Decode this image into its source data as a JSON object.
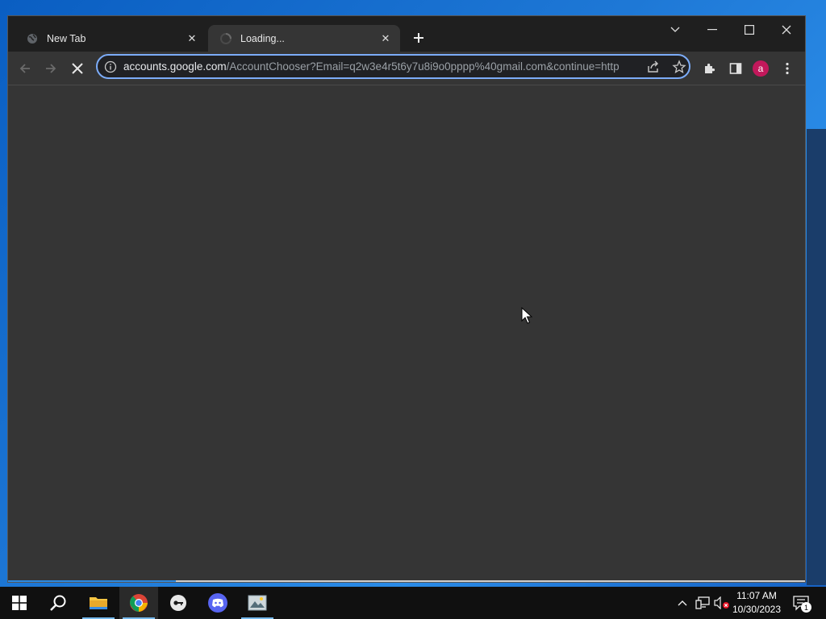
{
  "browser": {
    "tabs": [
      {
        "title": "New Tab",
        "favicon": "globe-icon",
        "active": false
      },
      {
        "title": "Loading...",
        "favicon": "loading-spinner-icon",
        "active": true
      }
    ],
    "url_host": "accounts.google.com",
    "url_path": "/AccountChooser?Email=q2w3e4r5t6y7u8i9o0pppp%40gmail.com&continue=http",
    "profile_initial": "a",
    "profile_color": "#c2185b",
    "accent_color": "#7cacf8"
  },
  "taskbar": {
    "time": "11:07 AM",
    "date": "10/30/2023",
    "notification_count": "1",
    "apps": [
      "windows-start-icon",
      "search-icon",
      "file-explorer-icon",
      "chrome-icon",
      "app-key-icon",
      "discord-icon",
      "image-viewer-icon"
    ]
  }
}
